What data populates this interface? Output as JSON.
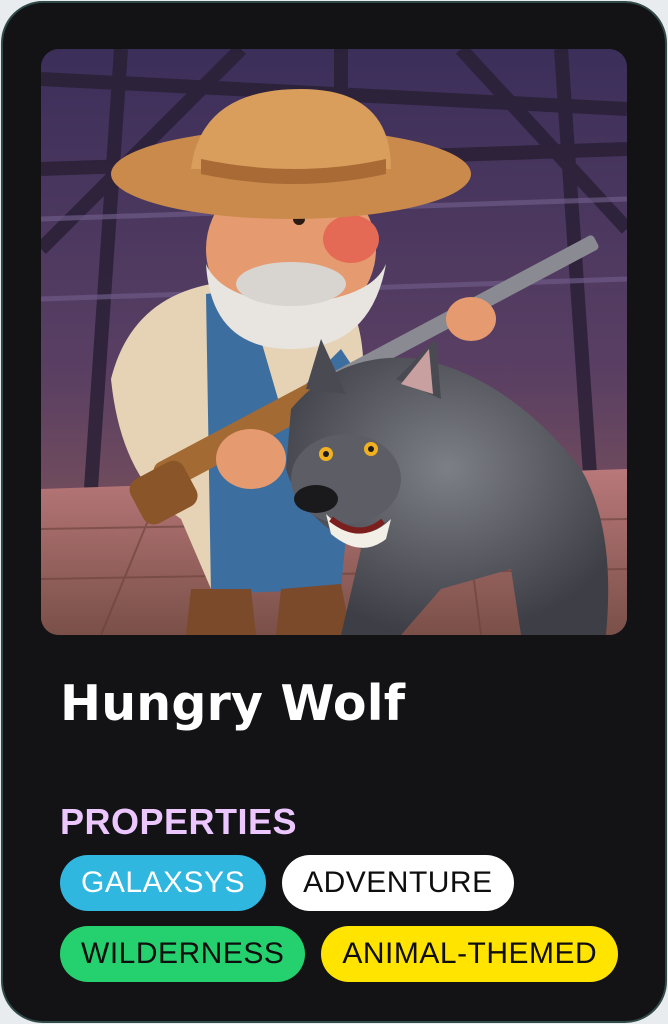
{
  "card": {
    "title": "Hungry Wolf",
    "image_alt": "Cartoon bearded farmer in cowboy hat holding a rifle beside a snarling grey wolf inside a wooden barn",
    "properties_label": "PROPERTIES",
    "tags": [
      {
        "label": "GALAXSYS",
        "color": "#2fb7e0"
      },
      {
        "label": "ADVENTURE",
        "color": "#ffffff"
      },
      {
        "label": "WILDERNESS",
        "color": "#25d06e"
      },
      {
        "label": "ANIMAL-THEMED",
        "color": "#ffe400"
      }
    ]
  }
}
